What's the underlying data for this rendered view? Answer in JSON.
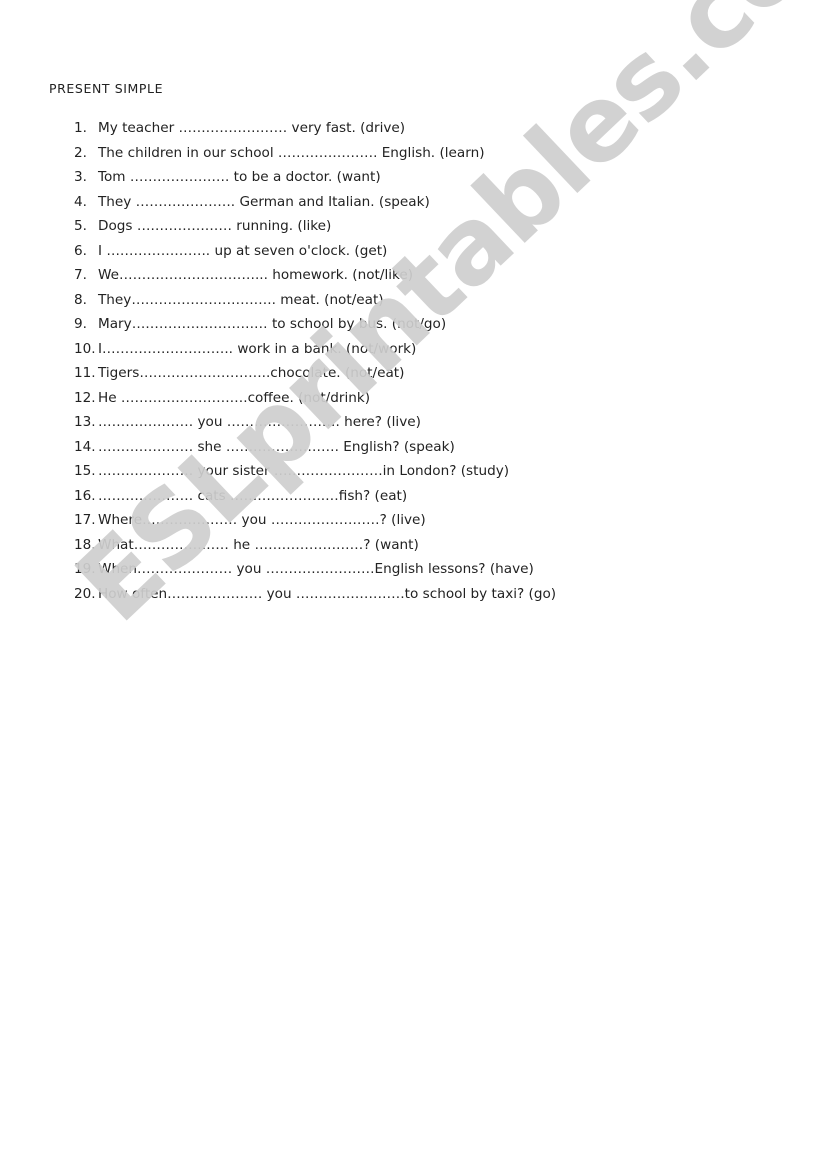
{
  "worksheet": {
    "title": "PRESENT SIMPLE",
    "items": [
      {
        "num": "1.",
        "text": "My teacher …………………… very fast. (drive)"
      },
      {
        "num": "2.",
        "text": "The children in our school …………………. English. (learn)"
      },
      {
        "num": "3.",
        "text": "Tom …………………. to be a doctor. (want)"
      },
      {
        "num": "4.",
        "text": "They …………………. German and Italian. (speak)"
      },
      {
        "num": "5.",
        "text": "Dogs ………………… running. (like)"
      },
      {
        "num": "6.",
        "text": "I ………………….. up at seven o'clock. (get)"
      },
      {
        "num": "7.",
        "text": "We…………………………... homework. (not/like)"
      },
      {
        "num": "8.",
        "text": "They………………………….. meat. (not/eat)"
      },
      {
        "num": "9.",
        "text": "Mary………………………… to school by bus. (not/go)"
      },
      {
        "num": "10.",
        "text": "I……………………….. work in a bank. (not/work)"
      },
      {
        "num": "11.",
        "text": "Tigers………………………..chocolate. (not/eat)"
      },
      {
        "num": "12.",
        "text": "He ……………………….coffee. (not/drink)"
      },
      {
        "num": "13.",
        "text": "………………… you ……………………. here? (live)"
      },
      {
        "num": "14.",
        "text": "………………… she ……………………. English? (speak)"
      },
      {
        "num": "15.",
        "text": "………………… your sister ……………………in London? (study)"
      },
      {
        "num": "16.",
        "text": "………………… cats ……………………fish? (eat)"
      },
      {
        "num": "17.",
        "text": "Where………………… you ……………………? (live)"
      },
      {
        "num": "18.",
        "text": "What………………… he ……………………? (want)"
      },
      {
        "num": "19.",
        "text": "When………………… you ……………………English lessons? (have)"
      },
      {
        "num": "20.",
        "text": "How often………………… you ……………………to school by taxi? (go)"
      }
    ]
  },
  "watermark": {
    "text": "ESLprintables.com",
    "color": "#cfcfcf"
  }
}
